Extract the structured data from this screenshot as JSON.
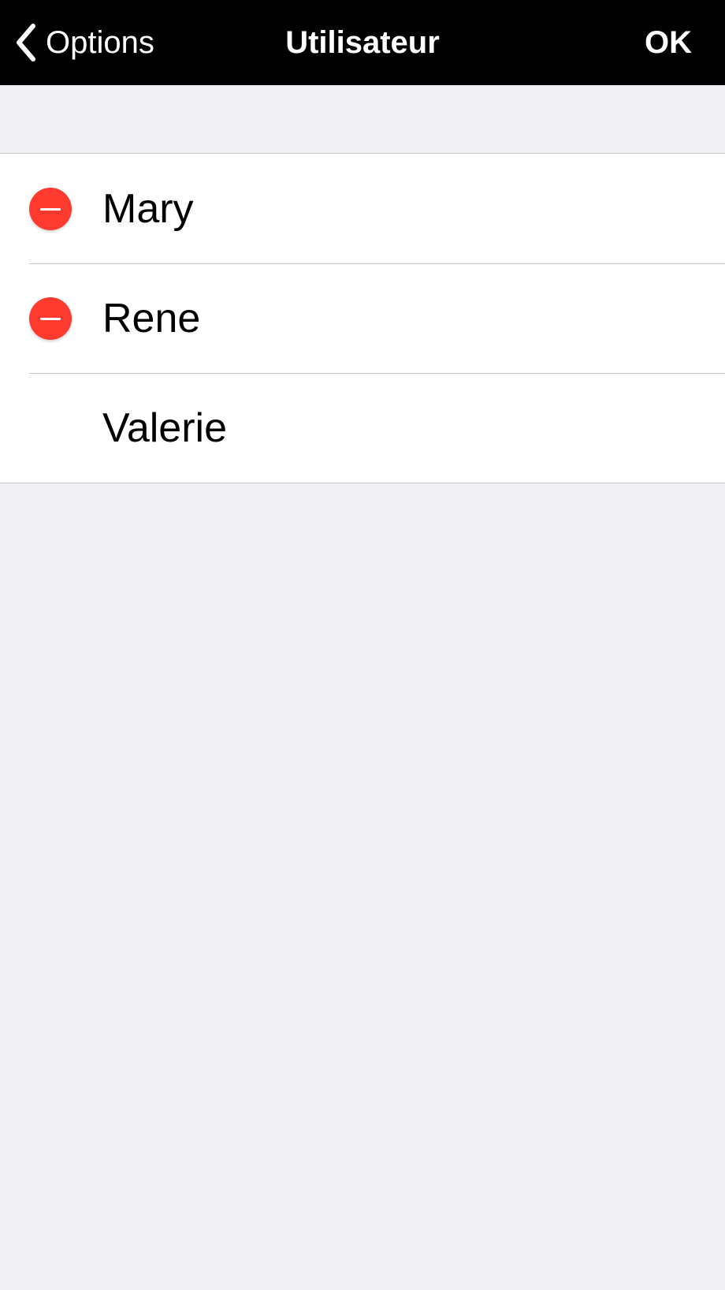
{
  "navbar": {
    "back_label": "Options",
    "title": "Utilisateur",
    "ok_label": "OK",
    "back_icon": "chevron-left-icon"
  },
  "users": {
    "items": [
      {
        "name": "Mary",
        "deletable": true
      },
      {
        "name": "Rene",
        "deletable": true
      },
      {
        "name": "Valerie",
        "deletable": false
      }
    ],
    "delete_icon": "minus-circle-icon"
  },
  "colors": {
    "navbar_bg": "#000000",
    "page_bg": "#efeff4",
    "delete_red": "#ff3b30",
    "separator": "#c8c7cc"
  }
}
